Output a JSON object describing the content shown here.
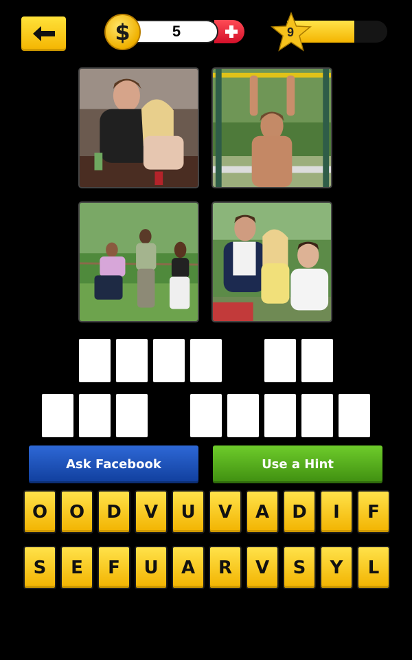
{
  "header": {
    "back_icon": "arrow-left-icon",
    "coin_symbol": "$",
    "coins": "5",
    "add_coins_icon": "plus-icon",
    "level": "9",
    "level_progress": 0.67
  },
  "pictures": [
    {
      "subject": "couple at table"
    },
    {
      "subject": "man on pull-up bar"
    },
    {
      "subject": "tug of war"
    },
    {
      "subject": "three friends"
    }
  ],
  "answer": {
    "row1_word_lengths": [
      4,
      2
    ],
    "row2_word_lengths": [
      3,
      5
    ]
  },
  "actions": {
    "ask_facebook": "Ask Facebook",
    "use_hint": "Use a Hint"
  },
  "keyboard": {
    "row1": [
      "O",
      "O",
      "D",
      "V",
      "U",
      "V",
      "A",
      "D",
      "I",
      "F"
    ],
    "row2": [
      "S",
      "E",
      "F",
      "U",
      "A",
      "R",
      "V",
      "S",
      "Y",
      "L"
    ]
  },
  "colors": {
    "key_yellow": "#f4b400",
    "facebook_blue": "#1f55c0",
    "hint_green": "#56ae1c",
    "plus_red": "#e01a2f"
  }
}
